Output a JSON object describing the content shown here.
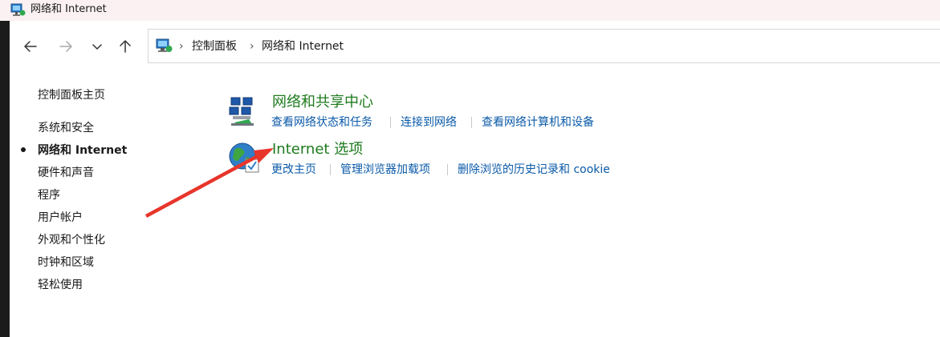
{
  "window": {
    "title": "网络和 Internet"
  },
  "address": {
    "crumbs": [
      "控制面板",
      "网络和 Internet"
    ]
  },
  "sidebar": {
    "home": "控制面板主页",
    "items": [
      "系统和安全",
      "网络和 Internet",
      "硬件和声音",
      "程序",
      "用户帐户",
      "外观和个性化",
      "时钟和区域",
      "轻松使用"
    ],
    "current_index": 1
  },
  "categories": [
    {
      "title": "网络和共享中心",
      "links": [
        "查看网络状态和任务",
        "连接到网络",
        "查看网络计算机和设备"
      ]
    },
    {
      "title": "Internet 选项",
      "links": [
        "更改主页",
        "管理浏览器加载项",
        "删除浏览的历史记录和 cookie"
      ]
    }
  ],
  "colors": {
    "title_green": "#1e7b1e",
    "link_blue": "#0a5aa8",
    "annotation_red": "#e8352b"
  }
}
